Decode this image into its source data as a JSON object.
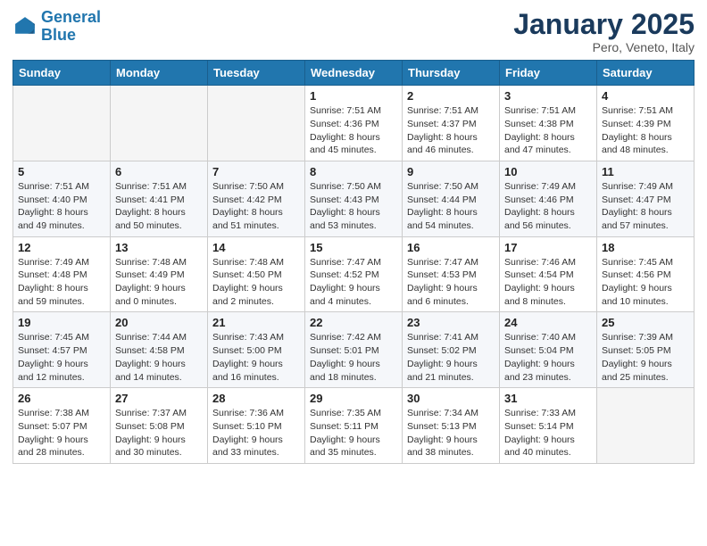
{
  "logo": {
    "line1": "General",
    "line2": "Blue"
  },
  "title": "January 2025",
  "subtitle": "Pero, Veneto, Italy",
  "headers": [
    "Sunday",
    "Monday",
    "Tuesday",
    "Wednesday",
    "Thursday",
    "Friday",
    "Saturday"
  ],
  "weeks": [
    [
      {
        "day": "",
        "info": ""
      },
      {
        "day": "",
        "info": ""
      },
      {
        "day": "",
        "info": ""
      },
      {
        "day": "1",
        "info": "Sunrise: 7:51 AM\nSunset: 4:36 PM\nDaylight: 8 hours\nand 45 minutes."
      },
      {
        "day": "2",
        "info": "Sunrise: 7:51 AM\nSunset: 4:37 PM\nDaylight: 8 hours\nand 46 minutes."
      },
      {
        "day": "3",
        "info": "Sunrise: 7:51 AM\nSunset: 4:38 PM\nDaylight: 8 hours\nand 47 minutes."
      },
      {
        "day": "4",
        "info": "Sunrise: 7:51 AM\nSunset: 4:39 PM\nDaylight: 8 hours\nand 48 minutes."
      }
    ],
    [
      {
        "day": "5",
        "info": "Sunrise: 7:51 AM\nSunset: 4:40 PM\nDaylight: 8 hours\nand 49 minutes."
      },
      {
        "day": "6",
        "info": "Sunrise: 7:51 AM\nSunset: 4:41 PM\nDaylight: 8 hours\nand 50 minutes."
      },
      {
        "day": "7",
        "info": "Sunrise: 7:50 AM\nSunset: 4:42 PM\nDaylight: 8 hours\nand 51 minutes."
      },
      {
        "day": "8",
        "info": "Sunrise: 7:50 AM\nSunset: 4:43 PM\nDaylight: 8 hours\nand 53 minutes."
      },
      {
        "day": "9",
        "info": "Sunrise: 7:50 AM\nSunset: 4:44 PM\nDaylight: 8 hours\nand 54 minutes."
      },
      {
        "day": "10",
        "info": "Sunrise: 7:49 AM\nSunset: 4:46 PM\nDaylight: 8 hours\nand 56 minutes."
      },
      {
        "day": "11",
        "info": "Sunrise: 7:49 AM\nSunset: 4:47 PM\nDaylight: 8 hours\nand 57 minutes."
      }
    ],
    [
      {
        "day": "12",
        "info": "Sunrise: 7:49 AM\nSunset: 4:48 PM\nDaylight: 8 hours\nand 59 minutes."
      },
      {
        "day": "13",
        "info": "Sunrise: 7:48 AM\nSunset: 4:49 PM\nDaylight: 9 hours\nand 0 minutes."
      },
      {
        "day": "14",
        "info": "Sunrise: 7:48 AM\nSunset: 4:50 PM\nDaylight: 9 hours\nand 2 minutes."
      },
      {
        "day": "15",
        "info": "Sunrise: 7:47 AM\nSunset: 4:52 PM\nDaylight: 9 hours\nand 4 minutes."
      },
      {
        "day": "16",
        "info": "Sunrise: 7:47 AM\nSunset: 4:53 PM\nDaylight: 9 hours\nand 6 minutes."
      },
      {
        "day": "17",
        "info": "Sunrise: 7:46 AM\nSunset: 4:54 PM\nDaylight: 9 hours\nand 8 minutes."
      },
      {
        "day": "18",
        "info": "Sunrise: 7:45 AM\nSunset: 4:56 PM\nDaylight: 9 hours\nand 10 minutes."
      }
    ],
    [
      {
        "day": "19",
        "info": "Sunrise: 7:45 AM\nSunset: 4:57 PM\nDaylight: 9 hours\nand 12 minutes."
      },
      {
        "day": "20",
        "info": "Sunrise: 7:44 AM\nSunset: 4:58 PM\nDaylight: 9 hours\nand 14 minutes."
      },
      {
        "day": "21",
        "info": "Sunrise: 7:43 AM\nSunset: 5:00 PM\nDaylight: 9 hours\nand 16 minutes."
      },
      {
        "day": "22",
        "info": "Sunrise: 7:42 AM\nSunset: 5:01 PM\nDaylight: 9 hours\nand 18 minutes."
      },
      {
        "day": "23",
        "info": "Sunrise: 7:41 AM\nSunset: 5:02 PM\nDaylight: 9 hours\nand 21 minutes."
      },
      {
        "day": "24",
        "info": "Sunrise: 7:40 AM\nSunset: 5:04 PM\nDaylight: 9 hours\nand 23 minutes."
      },
      {
        "day": "25",
        "info": "Sunrise: 7:39 AM\nSunset: 5:05 PM\nDaylight: 9 hours\nand 25 minutes."
      }
    ],
    [
      {
        "day": "26",
        "info": "Sunrise: 7:38 AM\nSunset: 5:07 PM\nDaylight: 9 hours\nand 28 minutes."
      },
      {
        "day": "27",
        "info": "Sunrise: 7:37 AM\nSunset: 5:08 PM\nDaylight: 9 hours\nand 30 minutes."
      },
      {
        "day": "28",
        "info": "Sunrise: 7:36 AM\nSunset: 5:10 PM\nDaylight: 9 hours\nand 33 minutes."
      },
      {
        "day": "29",
        "info": "Sunrise: 7:35 AM\nSunset: 5:11 PM\nDaylight: 9 hours\nand 35 minutes."
      },
      {
        "day": "30",
        "info": "Sunrise: 7:34 AM\nSunset: 5:13 PM\nDaylight: 9 hours\nand 38 minutes."
      },
      {
        "day": "31",
        "info": "Sunrise: 7:33 AM\nSunset: 5:14 PM\nDaylight: 9 hours\nand 40 minutes."
      },
      {
        "day": "",
        "info": ""
      }
    ]
  ]
}
